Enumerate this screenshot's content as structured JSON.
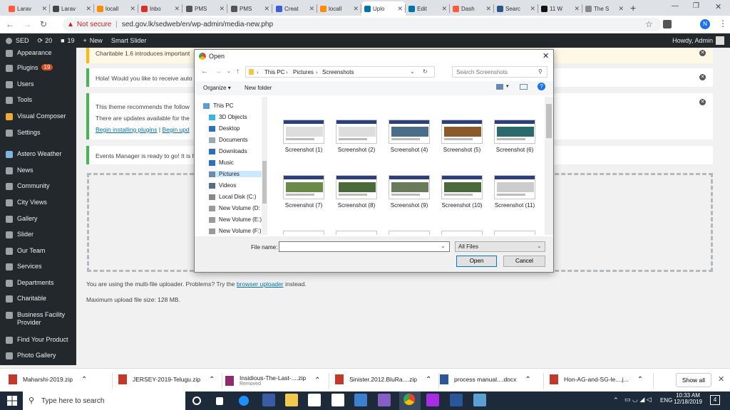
{
  "browser": {
    "tabs": [
      {
        "label": "Larav",
        "color": "#ff5a3c"
      },
      {
        "label": "Larav",
        "color": "#444444"
      },
      {
        "label": "locall",
        "color": "#ff8c00"
      },
      {
        "label": "Inbo",
        "color": "#d93025"
      },
      {
        "label": "PMS",
        "color": "#555555"
      },
      {
        "label": "PMS",
        "color": "#555555"
      },
      {
        "label": "Creat",
        "color": "#3b5bdb"
      },
      {
        "label": "locall",
        "color": "#ff8c00"
      },
      {
        "label": "Uplo",
        "color": "#0073aa"
      },
      {
        "label": "Edit",
        "color": "#0073aa"
      },
      {
        "label": "Dash",
        "color": "#ff5a3c"
      },
      {
        "label": "Searc",
        "color": "#2a5885"
      },
      {
        "label": "11 W",
        "color": "#111111"
      },
      {
        "label": "The S",
        "color": "#888888"
      }
    ],
    "active_tab_index": 8,
    "security": "Not secure",
    "url": "sed.gov.lk/sedweb/en/wp-admin/media-new.php",
    "profile_initial": "N"
  },
  "adminbar": {
    "site": "SED",
    "updates": "20",
    "comments": "19",
    "new": "New",
    "slider": "Smart Slider",
    "greeting": "Howdy, Admin"
  },
  "sidebar": {
    "items": [
      {
        "label": "Appearance"
      },
      {
        "label": "Plugins",
        "badge": "19"
      },
      {
        "label": "Users"
      },
      {
        "label": "Tools"
      },
      {
        "label": "Visual Composer"
      },
      {
        "label": "Settings"
      },
      {
        "label": "Astero Weather"
      },
      {
        "label": "News"
      },
      {
        "label": "Community"
      },
      {
        "label": "City Views"
      },
      {
        "label": "Gallery"
      },
      {
        "label": "Slider"
      },
      {
        "label": "Our Team"
      },
      {
        "label": "Services"
      },
      {
        "label": "Departments"
      },
      {
        "label": "Charitable"
      },
      {
        "label": "Business Facility Provider"
      },
      {
        "label": "Find Your Product"
      },
      {
        "label": "Photo Gallery"
      }
    ]
  },
  "notices": {
    "charitable": "Charitable 1.6 introduces important",
    "hola": "Hola! Would you like to receive auto",
    "theme_line1": "This theme recommends the follow",
    "theme_line2": "There are updates available for the",
    "theme_link1": "Begin installing plugins",
    "theme_sep": "|",
    "theme_link2": "Begin upd",
    "events": "Events Manager is ready to go! It is h"
  },
  "upload": {
    "multi_prefix": "You are using the multi-file uploader. Problems? Try the",
    "browser_link": "browser uploader",
    "multi_suffix": "instead.",
    "max_size": "Maximum upload file size: 128 MB."
  },
  "dialog": {
    "title": "Open",
    "breadcrumb": [
      "This PC",
      "Pictures",
      "Screenshots"
    ],
    "search_placeholder": "Search Screenshots",
    "organize": "Organize",
    "new_folder": "New folder",
    "nav_items": [
      "This PC",
      "3D Objects",
      "Desktop",
      "Documents",
      "Downloads",
      "Music",
      "Pictures",
      "Videos",
      "Local Disk (C:)",
      "New Volume (D:",
      "New Volume (E:)",
      "New Volume (F:)"
    ],
    "selected_nav": "Pictures",
    "files": [
      "Screenshot (1)",
      "Screenshot (2)",
      "Screenshot (4)",
      "Screenshot (5)",
      "Screenshot (6)",
      "Screenshot (7)",
      "Screenshot (8)",
      "Screenshot (9)",
      "Screenshot (10)",
      "Screenshot (11)"
    ],
    "file_name_label": "File name:",
    "file_name_value": "",
    "file_type": "All Files",
    "open_button": "Open",
    "cancel_button": "Cancel"
  },
  "downloads": {
    "items": [
      {
        "name": "Maharshi-2019.zip",
        "status": ""
      },
      {
        "name": "JERSEY-2019-Telugu.zip",
        "status": ""
      },
      {
        "name": "Insidious-The-Last-....zip",
        "status": "Removed"
      },
      {
        "name": "Sinister.2012.BluRa....zip",
        "status": ""
      },
      {
        "name": "process manual....docx",
        "status": ""
      },
      {
        "name": "Hon-AG-and-SG-le....j...",
        "status": ""
      }
    ],
    "show_all": "Show all"
  },
  "taskbar": {
    "search_placeholder": "Type here to search",
    "language": "ENG",
    "time": "10:33 AM",
    "date": "12/18/2019",
    "notification_count": "4"
  }
}
